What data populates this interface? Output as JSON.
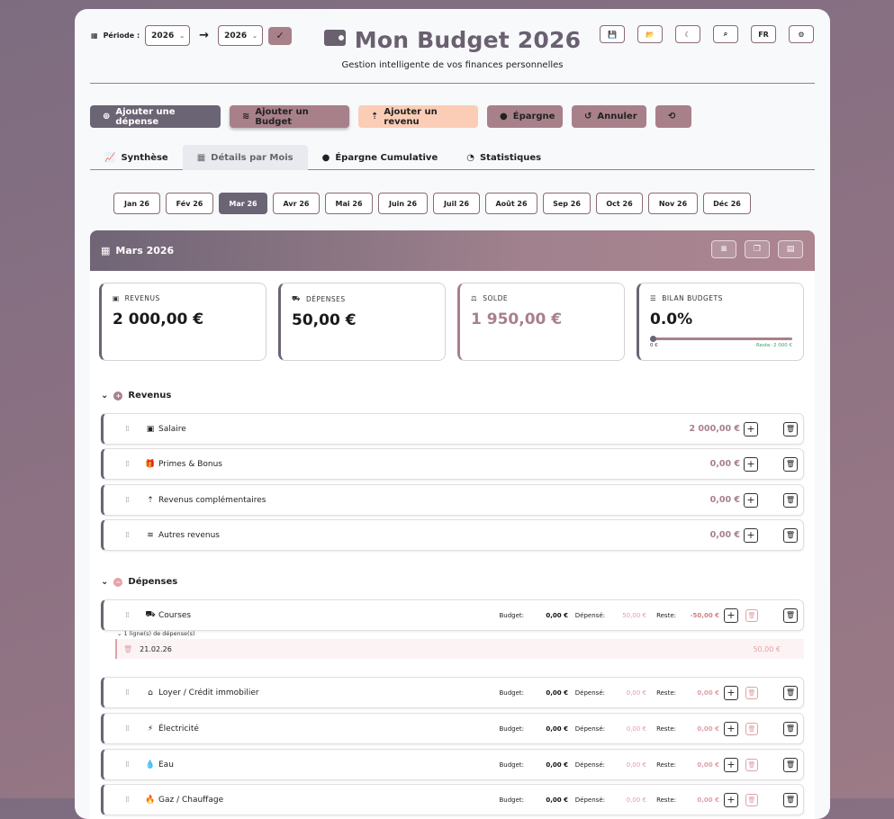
{
  "header": {
    "period_label": "Période :",
    "year_from": "2026",
    "year_to": "2026",
    "title": "Mon Budget 2026",
    "subtitle": "Gestion intelligente de vos finances personnelles",
    "lang": "FR"
  },
  "actions": {
    "add_expense": "Ajouter une dépense",
    "add_budget": "Ajouter un Budget",
    "add_income": "Ajouter un revenu",
    "savings": "Épargne",
    "cancel": "Annuler"
  },
  "tabs": [
    "Synthèse",
    "Détails par Mois",
    "Épargne Cumulative",
    "Statistiques"
  ],
  "months": [
    "Jan 26",
    "Fév 26",
    "Mar 26",
    "Avr 26",
    "Mai 26",
    "Juin 26",
    "Juil 26",
    "Août 26",
    "Sep 26",
    "Oct 26",
    "Nov 26",
    "Déc 26"
  ],
  "panel": {
    "title": "Mars 2026",
    "stats": {
      "revenus_label": "REVENUS",
      "revenus_value": "2 000,00 €",
      "depenses_label": "DÉPENSES",
      "depenses_value": "50,00 €",
      "solde_label": "SOLDE",
      "solde_value": "1 950,00 €",
      "bilan_label": "BILAN BUDGETS",
      "bilan_value": "0.0%",
      "bilan_progress_pct": 0,
      "bilan_left": "0 €",
      "bilan_right": "Reste: 2 000 €"
    },
    "revenus_title": "Revenus",
    "revenus": [
      {
        "label": "Salaire",
        "amount": "2 000,00 €"
      },
      {
        "label": "Primes & Bonus",
        "amount": "0,00 €"
      },
      {
        "label": "Revenus complémentaires",
        "amount": "0,00 €"
      },
      {
        "label": "Autres revenus",
        "amount": "0,00 €"
      }
    ],
    "depenses_title": "Dépenses",
    "field_labels": {
      "budget": "Budget:",
      "spent": "Dépensé:",
      "left": "Reste:"
    },
    "depenses": [
      {
        "label": "Courses",
        "budget": "0,00 €",
        "spent": "50,00 €",
        "left": "-50,00 €"
      },
      {
        "label": "Loyer / Crédit immobilier",
        "budget": "0,00 €",
        "spent": "0,00 €",
        "left": "0,00 €"
      },
      {
        "label": "Électricité",
        "budget": "0,00 €",
        "spent": "0,00 €",
        "left": "0,00 €"
      },
      {
        "label": "Eau",
        "budget": "0,00 €",
        "spent": "0,00 €",
        "left": "0,00 €"
      },
      {
        "label": "Gaz / Chauffage",
        "budget": "0,00 €",
        "spent": "0,00 €",
        "left": "0,00 €"
      }
    ],
    "courses_lines_toggle": "1 ligne(s) de dépense(s)",
    "courses_line": {
      "date": "21.02.26",
      "amount": "50,00 €"
    }
  }
}
